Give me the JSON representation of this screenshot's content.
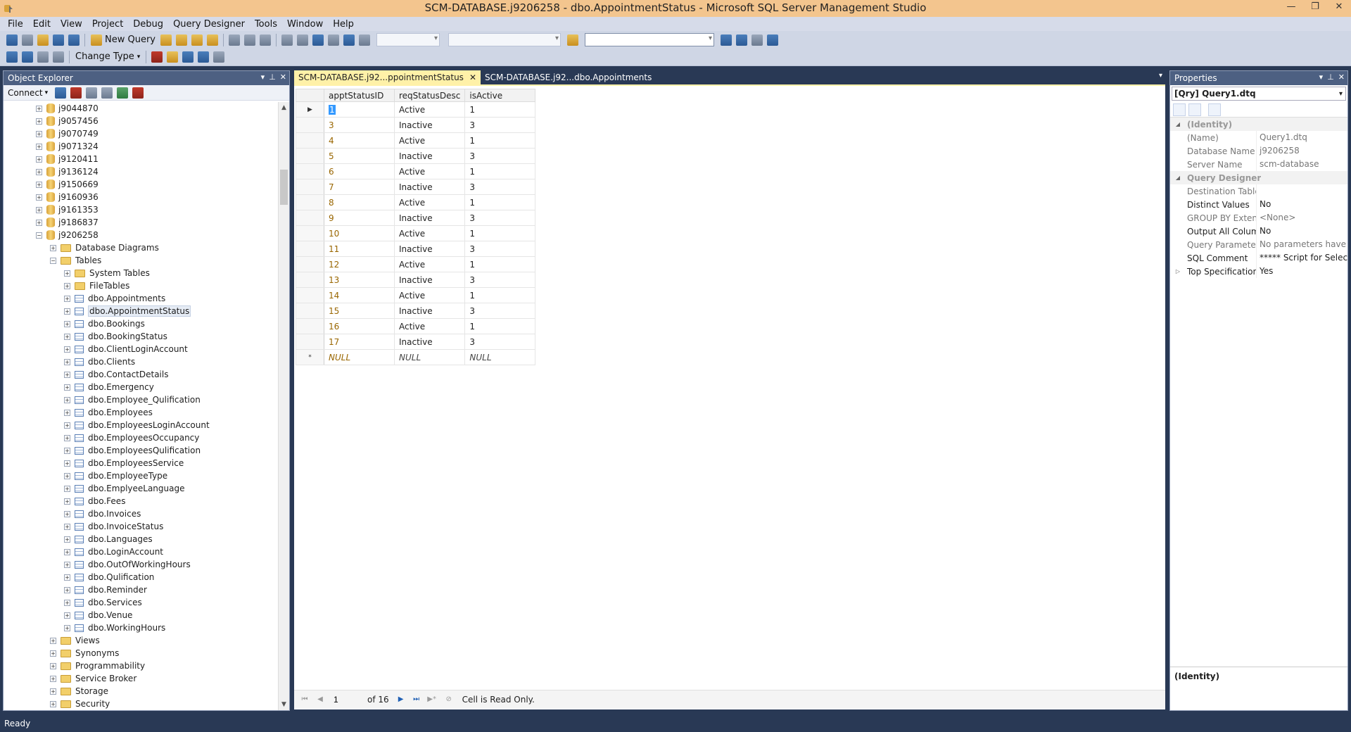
{
  "window": {
    "title": "SCM-DATABASE.j9206258 - dbo.AppointmentStatus - Microsoft SQL Server Management Studio",
    "controls": [
      "—",
      "❐",
      "✕"
    ]
  },
  "menu": [
    "File",
    "Edit",
    "View",
    "Project",
    "Debug",
    "Query Designer",
    "Tools",
    "Window",
    "Help"
  ],
  "toolbar": {
    "new_query": "New Query",
    "change_type": "Change Type"
  },
  "object_explorer": {
    "title": "Object Explorer",
    "connect": "Connect",
    "databases": [
      "j9044870",
      "j9057456",
      "j9070749",
      "j9071324",
      "j9120411",
      "j9136124",
      "j9150669",
      "j9160936",
      "j9161353",
      "j9186837"
    ],
    "current_db": "j9206258",
    "db_children": [
      "Database Diagrams",
      "Tables"
    ],
    "table_folders": [
      "System Tables",
      "FileTables"
    ],
    "tables": [
      "dbo.Appointments",
      "dbo.AppointmentStatus",
      "dbo.Bookings",
      "dbo.BookingStatus",
      "dbo.ClientLoginAccount",
      "dbo.Clients",
      "dbo.ContactDetails",
      "dbo.Emergency",
      "dbo.Employee_Qulification",
      "dbo.Employees",
      "dbo.EmployeesLoginAccount",
      "dbo.EmployeesOccupancy",
      "dbo.EmployeesQulification",
      "dbo.EmployeesService",
      "dbo.EmployeeType",
      "dbo.EmplyeeLanguage",
      "dbo.Fees",
      "dbo.Invoices",
      "dbo.InvoiceStatus",
      "dbo.Languages",
      "dbo.LoginAccount",
      "dbo.OutOfWorkingHours",
      "dbo.Qulification",
      "dbo.Reminder",
      "dbo.Services",
      "dbo.Venue",
      "dbo.WorkingHours"
    ],
    "other_folders": [
      "Views",
      "Synonyms",
      "Programmability",
      "Service Broker",
      "Storage",
      "Security"
    ]
  },
  "tabs": [
    {
      "label": "SCM-DATABASE.j92...ppointmentStatus",
      "active": true,
      "close": "✕"
    },
    {
      "label": "SCM-DATABASE.j92...dbo.Appointments",
      "active": false
    }
  ],
  "grid": {
    "columns": [
      "apptStatusID",
      "reqStatusDesc",
      "isActive"
    ],
    "rows": [
      [
        "1",
        "Active",
        "1"
      ],
      [
        "3",
        "Inactive",
        "3"
      ],
      [
        "4",
        "Active",
        "1"
      ],
      [
        "5",
        "Inactive",
        "3"
      ],
      [
        "6",
        "Active",
        "1"
      ],
      [
        "7",
        "Inactive",
        "3"
      ],
      [
        "8",
        "Active",
        "1"
      ],
      [
        "9",
        "Inactive",
        "3"
      ],
      [
        "10",
        "Active",
        "1"
      ],
      [
        "11",
        "Inactive",
        "3"
      ],
      [
        "12",
        "Active",
        "1"
      ],
      [
        "13",
        "Inactive",
        "3"
      ],
      [
        "14",
        "Active",
        "1"
      ],
      [
        "15",
        "Inactive",
        "3"
      ],
      [
        "16",
        "Active",
        "1"
      ],
      [
        "17",
        "Inactive",
        "3"
      ]
    ],
    "null_row": [
      "NULL",
      "NULL",
      "NULL"
    ],
    "new_row_marker": "*"
  },
  "navigator": {
    "page": "1",
    "of_label": "of 16",
    "status": "Cell is Read Only."
  },
  "properties": {
    "title": "Properties",
    "object": "[Qry] Query1.dtq",
    "rows": [
      {
        "type": "category",
        "name": "(Identity)",
        "gut": "◢"
      },
      {
        "type": "gray",
        "name": "(Name)",
        "value": "Query1.dtq"
      },
      {
        "type": "gray",
        "name": "Database Name",
        "value": "j9206258"
      },
      {
        "type": "gray",
        "name": "Server Name",
        "value": "scm-database"
      },
      {
        "type": "category",
        "name": "Query Designer",
        "gut": "◢"
      },
      {
        "type": "gray",
        "name": "Destination Table",
        "value": ""
      },
      {
        "type": "normal",
        "name": "Distinct Values",
        "value": "No"
      },
      {
        "type": "gray",
        "name": "GROUP BY Extensi",
        "value": "<None>"
      },
      {
        "type": "normal",
        "name": "Output All Colum",
        "value": "No"
      },
      {
        "type": "gray",
        "name": "Query Parameter I",
        "value": "No parameters have bee"
      },
      {
        "type": "normal",
        "name": "SQL Comment",
        "value": "***** Script for SelectTo"
      },
      {
        "type": "normal",
        "name": "Top Specification",
        "value": "Yes",
        "gut": "▷"
      }
    ],
    "description": "(Identity)"
  },
  "status_bar": "Ready"
}
